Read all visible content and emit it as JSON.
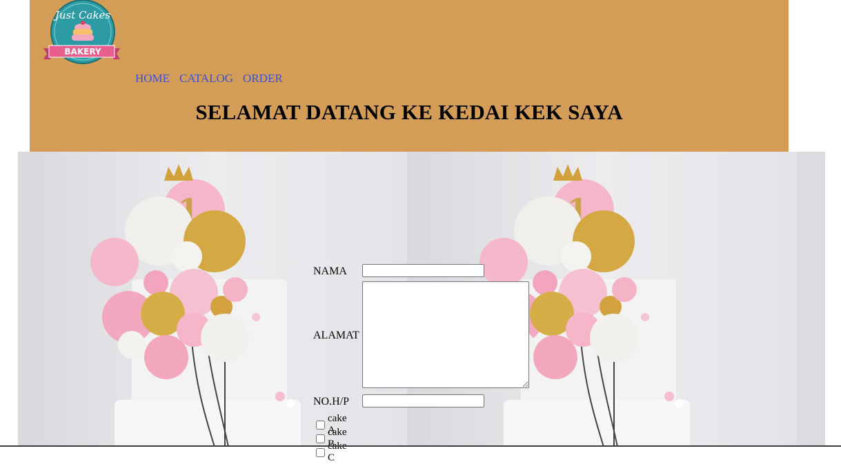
{
  "header": {
    "logo": {
      "line1": "Just Cakes",
      "ribbon": "BAKERY",
      "icon": "cake-logo-icon"
    },
    "nav": [
      {
        "label": "HOME"
      },
      {
        "label": "CATALOG"
      },
      {
        "label": "ORDER"
      }
    ],
    "title": "SELAMAT DATANG KE KEDAI KEK SAYA"
  },
  "banner": {
    "image": "balloon-cake-image",
    "cake_number": "1"
  },
  "form": {
    "nama_label": "NAMA",
    "nama_value": "",
    "alamat_label": "ALAMAT",
    "alamat_value": "",
    "nohp_label": "NO.H/P",
    "nohp_value": "",
    "options": [
      {
        "label": "cake A",
        "checked": false
      },
      {
        "label": "cake B",
        "checked": false
      },
      {
        "label": "cake C",
        "checked": false
      }
    ]
  },
  "colors": {
    "header_bg": "#d39d57",
    "nav_link": "#3b4fd8",
    "logo_teal": "#2d9ba3",
    "ribbon_pink": "#e85f8e"
  }
}
